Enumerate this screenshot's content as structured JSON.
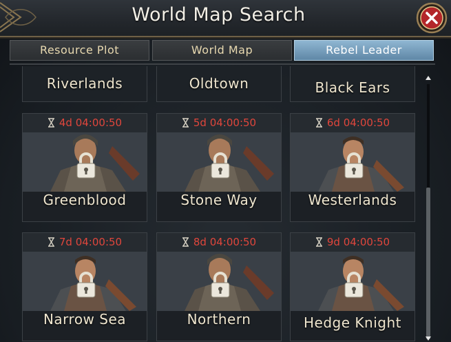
{
  "window": {
    "title": "World Map Search"
  },
  "tabs": [
    {
      "label": "Resource Plot",
      "active": false
    },
    {
      "label": "World Map",
      "active": false
    },
    {
      "label": "Rebel Leader",
      "active": true
    }
  ],
  "top_row": [
    {
      "name": "Riverlands"
    },
    {
      "name": "Oldtown"
    },
    {
      "name": "Black Ears"
    }
  ],
  "cards": [
    {
      "name": "Greenblood",
      "timer": "4d 04:00:50",
      "locked": true
    },
    {
      "name": "Stone Way",
      "timer": "5d 04:00:50",
      "locked": true
    },
    {
      "name": "Westerlands",
      "timer": "6d 04:00:50",
      "locked": true
    },
    {
      "name": "Narrow Sea",
      "timer": "7d 04:00:50",
      "locked": true
    },
    {
      "name": "Northern",
      "timer": "8d 04:00:50",
      "locked": true
    },
    {
      "name": "Hedge Knight",
      "timer": "9d 04:00:50",
      "locked": true
    }
  ],
  "colors": {
    "timer": "#e0463c",
    "active_tab": "#7aa3c2",
    "close_button": "#b3262a"
  },
  "icons": [
    "close-icon",
    "hourglass-icon",
    "padlock-icon",
    "scroll-up-icon",
    "scroll-down-icon"
  ]
}
